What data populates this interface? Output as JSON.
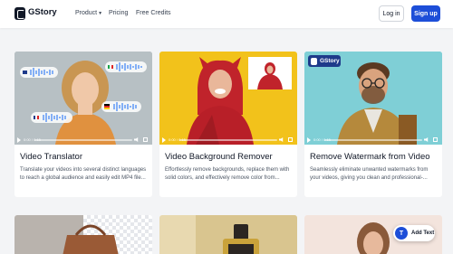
{
  "header": {
    "brand": "GStory",
    "nav": [
      {
        "label": "Product"
      },
      {
        "label": "Pricing"
      },
      {
        "label": "Free Credits"
      }
    ],
    "login": "Log in",
    "signup": "Sign up"
  },
  "cards": [
    {
      "title": "Video Translator",
      "description": "Translate your videos into several distinct languages to reach a global audience and easily edit MP4 file...",
      "video_time": "0:00 / 0:15"
    },
    {
      "title": "Video Background Remover",
      "description": "Effortlessly remove backgrounds, replace them with solid colors, and effectively remove color from...",
      "video_time": "0:00 / 0:15"
    },
    {
      "title": "Remove Watermark from Video",
      "description": "Seamlessly eliminate unwanted watermarks from your videos, giving you clean and professional-...",
      "video_time": "0:00 / 0:15",
      "badge": "GStory"
    }
  ],
  "floating": {
    "add_text": "Add Text",
    "icon_glyph": "T"
  },
  "colors": {
    "primary": "#1d4ed8",
    "background": "#f3f4f6",
    "yellow": "#f2c21b",
    "teal": "#6cc6cf"
  }
}
